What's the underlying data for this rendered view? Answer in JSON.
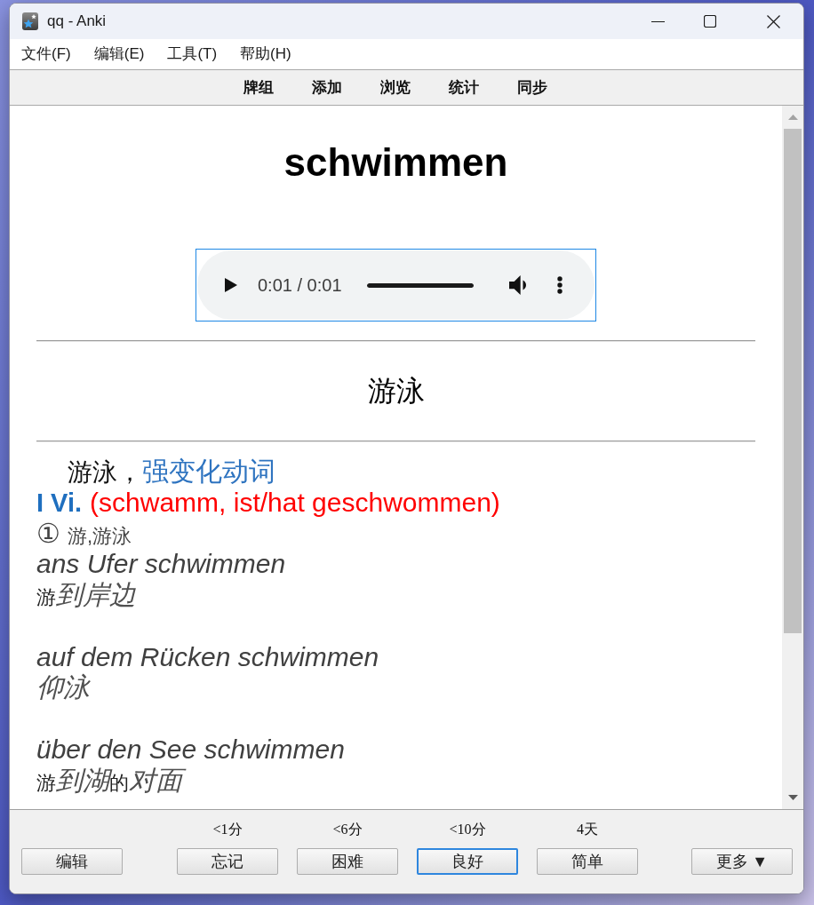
{
  "window": {
    "title": "qq - Anki"
  },
  "menu": [
    "文件(F)",
    "编辑(E)",
    "工具(T)",
    "帮助(H)"
  ],
  "toolbar": [
    "牌组",
    "添加",
    "浏览",
    "统计",
    "同步"
  ],
  "card": {
    "word": "schwimmen",
    "audio": {
      "time": "0:01 / 0:01",
      "level": 1
    },
    "meaning": "游泳",
    "entry": {
      "gloss": "游泳，",
      "word_class": "强变化动词",
      "grammar_label": "I Vi.",
      "forms": "(schwamm, ist/hat geschwommen)",
      "sense": {
        "number": "①",
        "meaning": "游,游泳"
      },
      "examples": [
        {
          "phrase": "ans Ufer schwimmen",
          "translation": [
            {
              "text": "游",
              "italic": false
            },
            {
              "text": "到岸边",
              "italic": true
            }
          ]
        },
        {
          "phrase": "auf dem Rücken schwimmen",
          "translation": [
            {
              "text": "仰泳",
              "italic": true
            }
          ]
        },
        {
          "phrase": "über den See schwimmen",
          "translation": [
            {
              "text": "游",
              "italic": false
            },
            {
              "text": "到湖",
              "italic": true
            },
            {
              "text": "的",
              "italic": false
            },
            {
              "text": "对面",
              "italic": true
            }
          ]
        }
      ]
    }
  },
  "answer_bar": {
    "edit_button": "编辑",
    "answers": [
      {
        "interval": "<1分",
        "label": "忘记",
        "focused": false
      },
      {
        "interval": "<6分",
        "label": "困难",
        "focused": false
      },
      {
        "interval": "<10分",
        "label": "良好",
        "focused": true
      },
      {
        "interval": "4天",
        "label": "简单",
        "focused": false
      }
    ],
    "more_button": "更多 ▼"
  }
}
